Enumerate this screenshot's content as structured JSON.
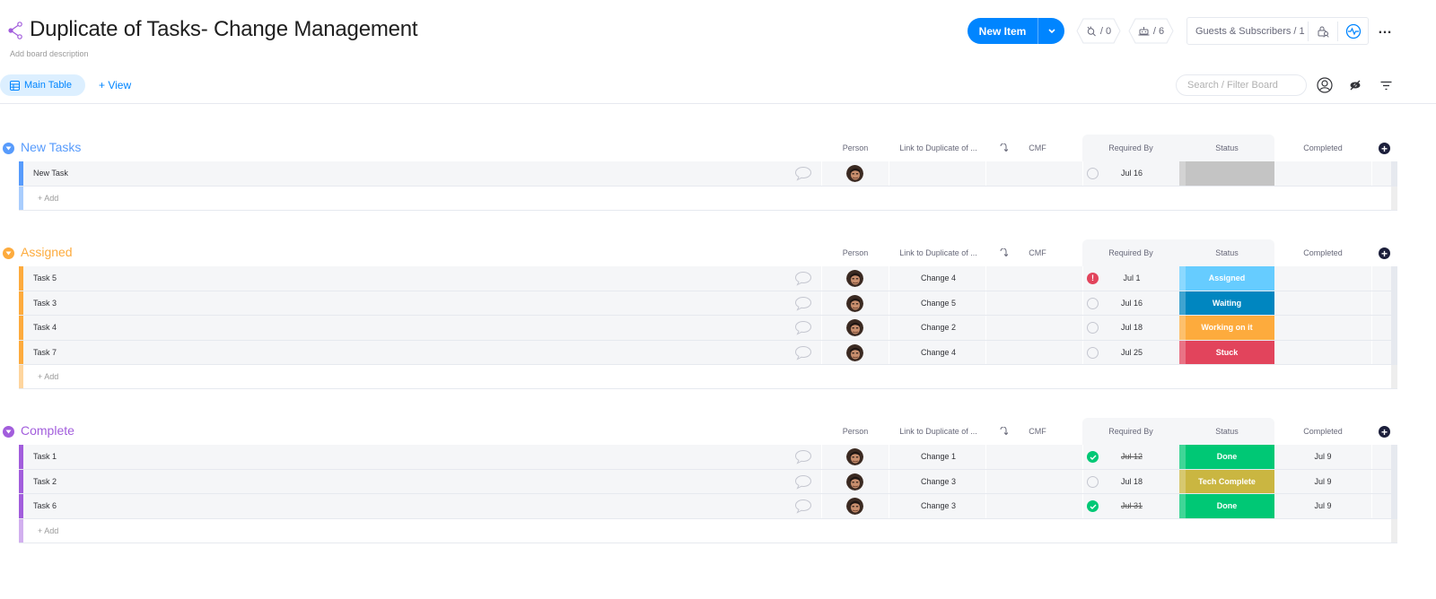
{
  "board": {
    "title": "Duplicate of Tasks- Change Management",
    "description_placeholder": "Add board description",
    "views": [
      {
        "label": "Main Table",
        "active": true
      }
    ],
    "add_view_label": "+ View"
  },
  "toolbar": {
    "new_item_label": "New Item",
    "integrations_count": "/ 0",
    "automations_count": "/ 6",
    "guests_label": "Guests & Subscribers / 1",
    "more_label": "…",
    "search_placeholder": "Search / Filter Board",
    "accent_color": "#0085ff"
  },
  "columns": {
    "person": "Person",
    "link": "Link to Duplicate of ...",
    "cmf": "CMF",
    "required_by": "Required By",
    "status": "Status",
    "completed": "Completed"
  },
  "status_colors": {
    "Assigned": "#66ccff",
    "Waiting": "#0086c0",
    "Working on it": "#fdab3d",
    "Stuck": "#e2445c",
    "Done": "#00c875",
    "Tech Complete": "#cab641",
    "": "#c4c4c4"
  },
  "groups": [
    {
      "name": "New Tasks",
      "color": "#579bfc",
      "light_color": "#a9cdfd",
      "add_label": "+ Add",
      "items": [
        {
          "name": "New Task",
          "link": "",
          "date_state": "empty",
          "required_by": "Jul 16",
          "status": "",
          "completed": ""
        }
      ]
    },
    {
      "name": "Assigned",
      "color": "#fdab3d",
      "light_color": "#fed59e",
      "add_label": "+ Add",
      "items": [
        {
          "name": "Task 5",
          "link": "Change 4",
          "date_state": "overdue",
          "required_by": "Jul 1",
          "status": "Assigned",
          "completed": ""
        },
        {
          "name": "Task 3",
          "link": "Change 5",
          "date_state": "empty",
          "required_by": "Jul 16",
          "status": "Waiting",
          "completed": ""
        },
        {
          "name": "Task 4",
          "link": "Change 2",
          "date_state": "empty",
          "required_by": "Jul 18",
          "status": "Working on it",
          "completed": ""
        },
        {
          "name": "Task 7",
          "link": "Change 4",
          "date_state": "empty",
          "required_by": "Jul 25",
          "status": "Stuck",
          "completed": ""
        }
      ]
    },
    {
      "name": "Complete",
      "color": "#a25ddc",
      "light_color": "#d2b0ef",
      "add_label": "+ Add",
      "items": [
        {
          "name": "Task 1",
          "link": "Change 1",
          "date_state": "done",
          "required_by": "Jul 12",
          "status": "Done",
          "completed": "Jul 9"
        },
        {
          "name": "Task 2",
          "link": "Change 3",
          "date_state": "empty",
          "required_by": "Jul 18",
          "status": "Tech Complete",
          "completed": "Jul 9"
        },
        {
          "name": "Task 6",
          "link": "Change 3",
          "date_state": "done",
          "required_by": "Jul 31",
          "status": "Done",
          "completed": "Jul 9"
        }
      ]
    }
  ]
}
